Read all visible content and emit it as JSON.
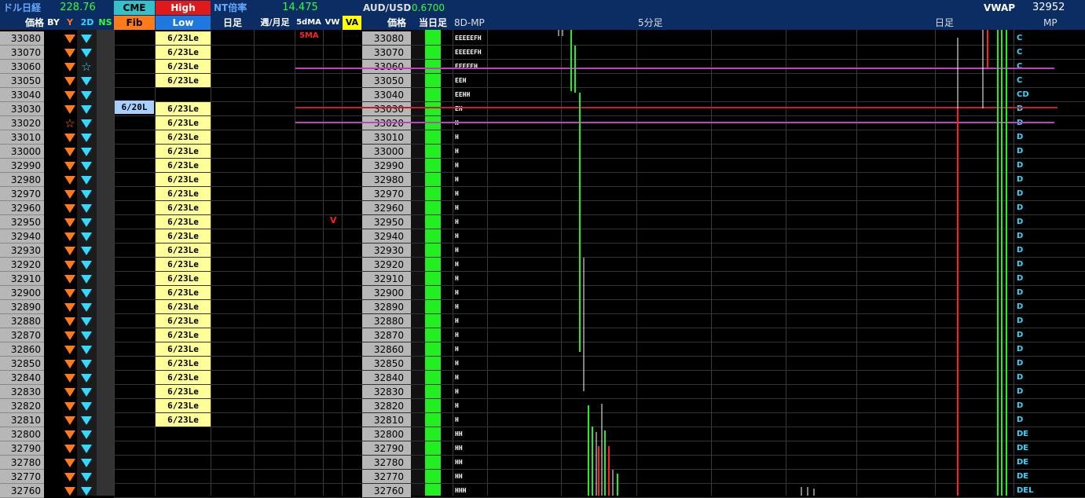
{
  "header": {
    "dollar_nikkei_label": "ドル日経",
    "dollar_nikkei_value": "228.76",
    "cme_label": "CME",
    "high_label": "High",
    "nt_label": "NT倍率",
    "nt_value": "14.475",
    "audusd_label": "AUD/USD",
    "audusd_value": "0.6700",
    "vwap_label": "VWAP",
    "vwap_value": "32952",
    "price_label": "価格",
    "by_label": "BY",
    "y_label": "Y",
    "twod_label": "2D",
    "ns_label": "NS",
    "fib_label": "Fib",
    "low_label": "Low",
    "daily_label": "日足",
    "weekly_monthly_label": "週/月足",
    "fivedma_label": "5dMA",
    "vw_label": "VW",
    "va_label": "VA",
    "price_label2": "価格",
    "today_label": "当日足",
    "eightd_mp_label": "8D-MP",
    "fivemin_label": "5分足",
    "daily_label2": "日足",
    "mp_label": "MP"
  },
  "rows": [
    {
      "price": "33080",
      "low": "6/23Le",
      "mp": "EEEEEFH",
      "mpr": "C"
    },
    {
      "price": "33070",
      "low": "6/23Le",
      "mp": "EEEEEFH",
      "mpr": "C"
    },
    {
      "price": "33060",
      "low": "6/23Le",
      "mp": "EEEEEH",
      "mpr": "C"
    },
    {
      "price": "33050",
      "low": "6/23Le",
      "mp": "EEH",
      "mpr": "C"
    },
    {
      "price": "33040",
      "low": "",
      "mp": "EEHH",
      "mpr": "CD"
    },
    {
      "price": "33030",
      "low": "6/23Le",
      "mp": "EH",
      "mpr": "D"
    },
    {
      "price": "33020",
      "low": "6/23Le",
      "mp": "H",
      "mpr": "D"
    },
    {
      "price": "33010",
      "low": "6/23Le",
      "mp": "H",
      "mpr": "D"
    },
    {
      "price": "33000",
      "low": "6/23Le",
      "mp": "H",
      "mpr": "D"
    },
    {
      "price": "32990",
      "low": "6/23Le",
      "mp": "H",
      "mpr": "D"
    },
    {
      "price": "32980",
      "low": "6/23Le",
      "mp": "H",
      "mpr": "D"
    },
    {
      "price": "32970",
      "low": "6/23Le",
      "mp": "H",
      "mpr": "D"
    },
    {
      "price": "32960",
      "low": "6/23Le",
      "mp": "H",
      "mpr": "D"
    },
    {
      "price": "32950",
      "low": "6/23Le",
      "mp": "H",
      "mpr": "D"
    },
    {
      "price": "32940",
      "low": "6/23Le",
      "mp": "H",
      "mpr": "D"
    },
    {
      "price": "32930",
      "low": "6/23Le",
      "mp": "H",
      "mpr": "D"
    },
    {
      "price": "32920",
      "low": "6/23Le",
      "mp": "H",
      "mpr": "D"
    },
    {
      "price": "32910",
      "low": "6/23Le",
      "mp": "H",
      "mpr": "D"
    },
    {
      "price": "32900",
      "low": "6/23Le",
      "mp": "H",
      "mpr": "D"
    },
    {
      "price": "32890",
      "low": "6/23Le",
      "mp": "H",
      "mpr": "D"
    },
    {
      "price": "32880",
      "low": "6/23Le",
      "mp": "H",
      "mpr": "D"
    },
    {
      "price": "32870",
      "low": "6/23Le",
      "mp": "H",
      "mpr": "D"
    },
    {
      "price": "32860",
      "low": "6/23Le",
      "mp": "H",
      "mpr": "D"
    },
    {
      "price": "32850",
      "low": "6/23Le",
      "mp": "H",
      "mpr": "D"
    },
    {
      "price": "32840",
      "low": "6/23Le",
      "mp": "H",
      "mpr": "D"
    },
    {
      "price": "32830",
      "low": "6/23Le",
      "mp": "H",
      "mpr": "D"
    },
    {
      "price": "32820",
      "low": "6/23Le",
      "mp": "H",
      "mpr": "D"
    },
    {
      "price": "32810",
      "low": "6/23Le",
      "mp": "H",
      "mpr": "D"
    },
    {
      "price": "32800",
      "low": "",
      "mp": "HH",
      "mpr": "DE"
    },
    {
      "price": "32790",
      "low": "",
      "mp": "HH",
      "mpr": "DE"
    },
    {
      "price": "32780",
      "low": "",
      "mp": "HH",
      "mpr": "DE"
    },
    {
      "price": "32770",
      "low": "",
      "mp": "HH",
      "mpr": "DE"
    },
    {
      "price": "32760",
      "low": "",
      "mp": "HHH",
      "mpr": "DEL"
    }
  ],
  "markers": {
    "fib_6_20": "6/20L",
    "fivema_tag": "5MA",
    "v_tag": "V"
  },
  "colors": {
    "header_bg": "#0b2d63",
    "price_bg": "#b7b7b7",
    "low_bg": "#ffff99",
    "green_bar": "#22ee22",
    "orange": "#ff7a1a",
    "cyan": "#33d9ff"
  }
}
